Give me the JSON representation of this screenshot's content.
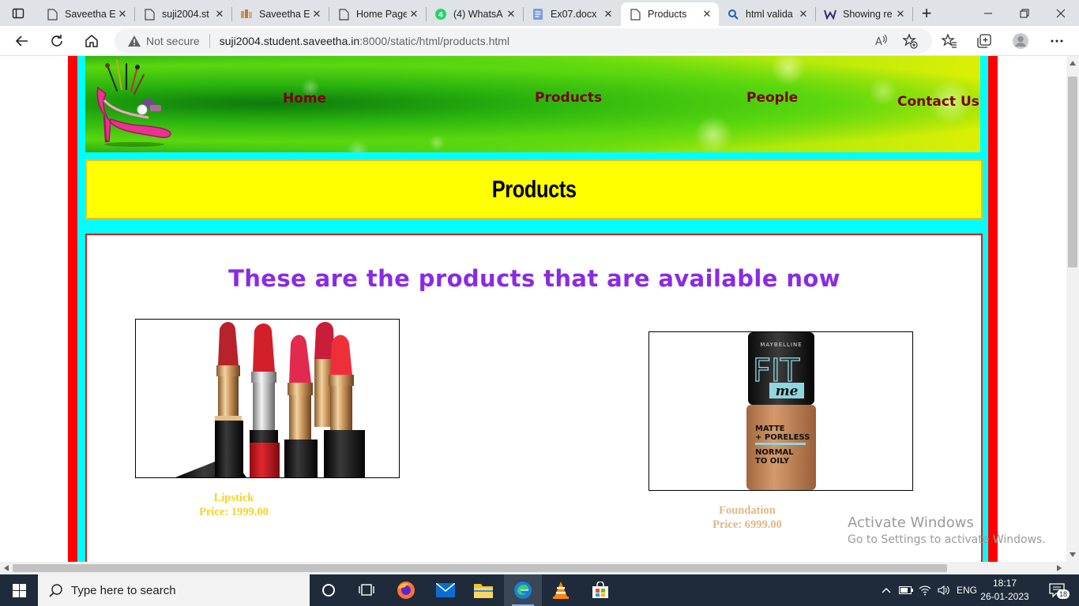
{
  "browser": {
    "tabs": [
      {
        "title": "Saveetha E",
        "icon": "page-icon",
        "active": false
      },
      {
        "title": "suji2004.st",
        "icon": "page-icon",
        "active": false
      },
      {
        "title": "Saveetha E",
        "icon": "saveetha-icon",
        "active": false
      },
      {
        "title": "Home Page",
        "icon": "page-icon",
        "active": false
      },
      {
        "title": "(4) WhatsA",
        "icon": "whatsapp-icon",
        "active": false
      },
      {
        "title": "Ex07.docx",
        "icon": "document-icon",
        "active": false
      },
      {
        "title": "Products",
        "icon": "page-icon",
        "active": true
      },
      {
        "title": "html valida",
        "icon": "search-icon",
        "active": false
      },
      {
        "title": "Showing re",
        "icon": "site-icon",
        "active": false
      }
    ],
    "new_tab_symbol": "+",
    "security_label": "Not secure",
    "url_host": "suji2004.student.saveetha.in",
    "url_rest": ":8000/static/html/products.html"
  },
  "site": {
    "nav": {
      "home": "Home",
      "products": "Products",
      "people": "People",
      "contact": "Contact Us"
    },
    "page_title": "Products",
    "intro": "These are the products that are available now",
    "products": [
      {
        "name": "Lipstick",
        "price": "Price: 1999.00",
        "caption_color": "#f2d42a"
      },
      {
        "name": "Foundation",
        "price": "Price: 6999.00",
        "caption_color": "#deb887"
      }
    ]
  },
  "watermark": {
    "line1": "Activate Windows",
    "line2": "Go to Settings to activate Windows."
  },
  "taskbar": {
    "search_placeholder": "Type here to search",
    "language": "ENG",
    "time": "18:17",
    "date": "26-01-2023",
    "notification_count": "18"
  }
}
